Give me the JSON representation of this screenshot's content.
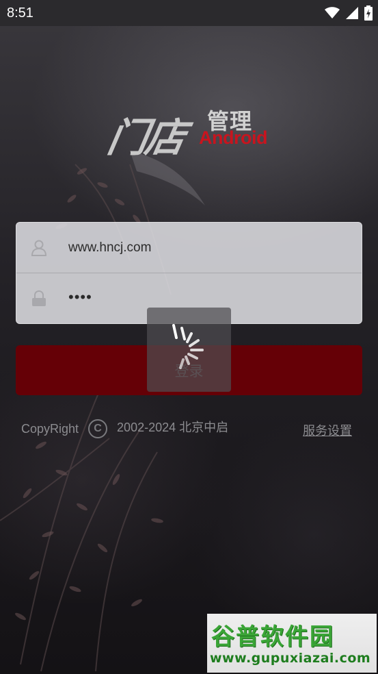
{
  "status_bar": {
    "time": "8:51",
    "icons": [
      "wifi-icon",
      "signal-icon",
      "battery-charging-icon"
    ]
  },
  "logo": {
    "main": "门店",
    "sub": "管理",
    "platform": "Android"
  },
  "login_form": {
    "username_value": "www.hncj.com",
    "password_mask": "••••",
    "user_icon": "user-icon",
    "lock_icon": "lock-icon"
  },
  "login_button": {
    "label": "登录"
  },
  "loading": {
    "icon": "spinner-icon"
  },
  "footer": {
    "copyright_label": "CopyRight",
    "copyright_symbol": "C",
    "copyright_years": "2002-2024 北京中启",
    "service_settings": "服务设置"
  },
  "watermark": {
    "title": "谷普软件园",
    "url": "www.gupuxiazai.com"
  },
  "colors": {
    "accent": "#650006",
    "logo_red": "#c8141e",
    "watermark_green": "#3aa536"
  }
}
